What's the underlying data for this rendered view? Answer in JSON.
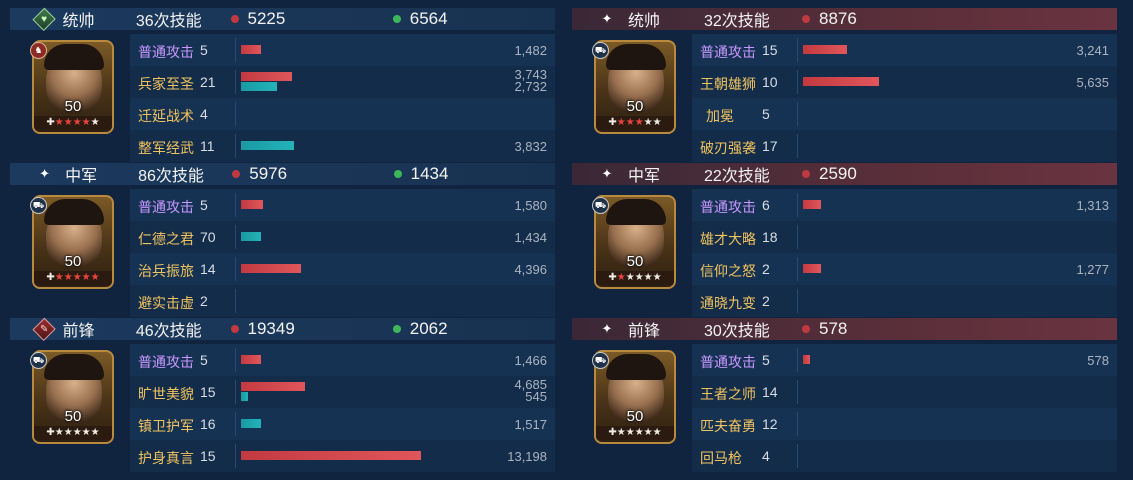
{
  "colors": {
    "attack_red": "#c23a40",
    "heal_teal": "#1a9aa2",
    "basic_attack_purple": "#c897ff",
    "skill_gold": "#f0c35f",
    "damage_dot": "#c0393f",
    "heal_dot": "#3cb85a"
  },
  "left_team": [
    {
      "role": "统帅",
      "role_icon": "diamond-green-icon",
      "skill_count": "36次技能",
      "damage": "5225",
      "heal": "6564",
      "level": "50",
      "stars_lit": 4,
      "badge_icon": "red-cavalry-badge-icon",
      "skills": [
        {
          "name": "普通攻击",
          "level": "5",
          "basic": true,
          "values": [
            "1,482"
          ],
          "bars": [
            {
              "type": "red",
              "fraction": 0.11
            }
          ]
        },
        {
          "name": "兵家至圣",
          "level": "21",
          "basic": false,
          "values": [
            "3,743",
            "2,732"
          ],
          "bars": [
            {
              "type": "red",
              "fraction": 0.28
            },
            {
              "type": "teal",
              "fraction": 0.2
            }
          ]
        },
        {
          "name": "迁延战术",
          "level": "4",
          "basic": false,
          "values": [],
          "bars": []
        },
        {
          "name": "整军经武",
          "level": "11",
          "basic": false,
          "values": [
            "3,832"
          ],
          "bars": [
            {
              "type": "teal",
              "fraction": 0.29
            }
          ]
        }
      ]
    },
    {
      "role": "中军",
      "role_icon": "sparkle-icon",
      "skill_count": "86次技能",
      "damage": "5976",
      "heal": "1434",
      "level": "50",
      "stars_lit": 5,
      "badge_icon": "vehicle-badge-icon",
      "skills": [
        {
          "name": "普通攻击",
          "level": "5",
          "basic": true,
          "values": [
            "1,580"
          ],
          "bars": [
            {
              "type": "red",
              "fraction": 0.12
            }
          ]
        },
        {
          "name": "仁德之君",
          "level": "70",
          "basic": false,
          "values": [
            "1,434"
          ],
          "bars": [
            {
              "type": "teal",
              "fraction": 0.11
            }
          ]
        },
        {
          "name": "治兵振旅",
          "level": "14",
          "basic": false,
          "values": [
            "4,396"
          ],
          "bars": [
            {
              "type": "red",
              "fraction": 0.33
            }
          ]
        },
        {
          "name": "避实击虚",
          "level": "2",
          "basic": false,
          "values": [],
          "bars": []
        }
      ]
    },
    {
      "role": "前锋",
      "role_icon": "diamond-red-icon",
      "skill_count": "46次技能",
      "damage": "19349",
      "heal": "2062",
      "level": "50",
      "stars_lit": 0,
      "badge_icon": "vehicle-badge-icon",
      "skills": [
        {
          "name": "普通攻击",
          "level": "5",
          "basic": true,
          "values": [
            "1,466"
          ],
          "bars": [
            {
              "type": "red",
              "fraction": 0.11
            }
          ]
        },
        {
          "name": "旷世美貌",
          "level": "15",
          "basic": false,
          "values": [
            "4,685",
            "545"
          ],
          "bars": [
            {
              "type": "red",
              "fraction": 0.35
            },
            {
              "type": "teal",
              "fraction": 0.04
            }
          ]
        },
        {
          "name": "镇卫护军",
          "level": "16",
          "basic": false,
          "values": [
            "1,517"
          ],
          "bars": [
            {
              "type": "teal",
              "fraction": 0.11
            }
          ]
        },
        {
          "name": "护身真言",
          "level": "15",
          "basic": false,
          "values": [
            "13,198"
          ],
          "bars": [
            {
              "type": "red",
              "fraction": 0.99
            }
          ]
        }
      ]
    }
  ],
  "right_team": [
    {
      "role": "统帅",
      "role_icon": "sparkle-icon",
      "skill_count": "32次技能",
      "damage": "8876",
      "level": "50",
      "stars_lit": 3,
      "badge_icon": "vehicle-badge-icon",
      "skills": [
        {
          "name": "普通攻击",
          "level": "15",
          "basic": true,
          "values": [
            "3,241"
          ],
          "bars": [
            {
              "type": "red",
              "fraction": 0.24
            }
          ]
        },
        {
          "name": "王朝雄狮",
          "level": "10",
          "basic": false,
          "values": [
            "5,635"
          ],
          "bars": [
            {
              "type": "red",
              "fraction": 0.42
            }
          ]
        },
        {
          "name": "加冕",
          "level": "5",
          "basic": false,
          "values": [],
          "bars": []
        },
        {
          "name": "破刃强袭",
          "level": "17",
          "basic": false,
          "values": [],
          "bars": []
        }
      ]
    },
    {
      "role": "中军",
      "role_icon": "sparkle-icon",
      "skill_count": "22次技能",
      "damage": "2590",
      "level": "50",
      "stars_lit": 1,
      "badge_icon": "vehicle-badge-icon",
      "skills": [
        {
          "name": "普通攻击",
          "level": "6",
          "basic": true,
          "values": [
            "1,313"
          ],
          "bars": [
            {
              "type": "red",
              "fraction": 0.1
            }
          ]
        },
        {
          "name": "雄才大略",
          "level": "18",
          "basic": false,
          "values": [],
          "bars": []
        },
        {
          "name": "信仰之怒",
          "level": "2",
          "basic": false,
          "values": [
            "1,277"
          ],
          "bars": [
            {
              "type": "red",
              "fraction": 0.1
            }
          ]
        },
        {
          "name": "通晓九变",
          "level": "2",
          "basic": false,
          "values": [],
          "bars": []
        }
      ]
    },
    {
      "role": "前锋",
      "role_icon": "sparkle-icon",
      "skill_count": "30次技能",
      "damage": "578",
      "level": "50",
      "stars_lit": 0,
      "badge_icon": "vehicle-badge-icon",
      "skills": [
        {
          "name": "普通攻击",
          "level": "5",
          "basic": true,
          "values": [
            "578"
          ],
          "bars": [
            {
              "type": "red",
              "fraction": 0.04
            }
          ]
        },
        {
          "name": "王者之师",
          "level": "14",
          "basic": false,
          "values": [],
          "bars": []
        },
        {
          "name": "匹夫奋勇",
          "level": "12",
          "basic": false,
          "values": [],
          "bars": []
        },
        {
          "name": "回马枪",
          "level": "4",
          "basic": false,
          "values": [],
          "bars": []
        }
      ]
    }
  ]
}
